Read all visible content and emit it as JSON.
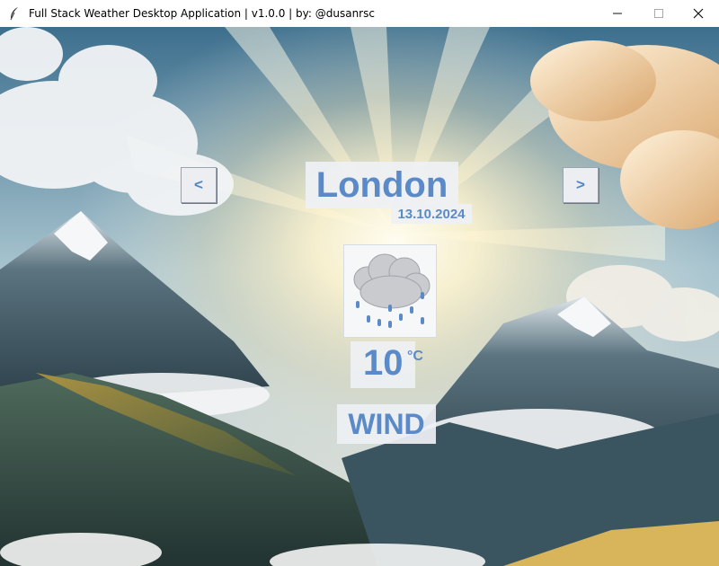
{
  "window": {
    "title": "Full Stack Weather Desktop Application | v1.0.0 | by: @dusanrsc",
    "icon": "feather-icon",
    "controls": [
      "minimize-icon",
      "maximize-icon",
      "close-icon"
    ]
  },
  "weather": {
    "prev_label": "<",
    "next_label": ">",
    "city": "London",
    "date": "13.10.2024",
    "condition_icon": "rain-cloud-icon",
    "temperature": "10",
    "unit": "°C",
    "wind_label": "WIND"
  },
  "colors": {
    "accent_text": "#5b8ac8",
    "panel_bg": "#eef0f4"
  }
}
